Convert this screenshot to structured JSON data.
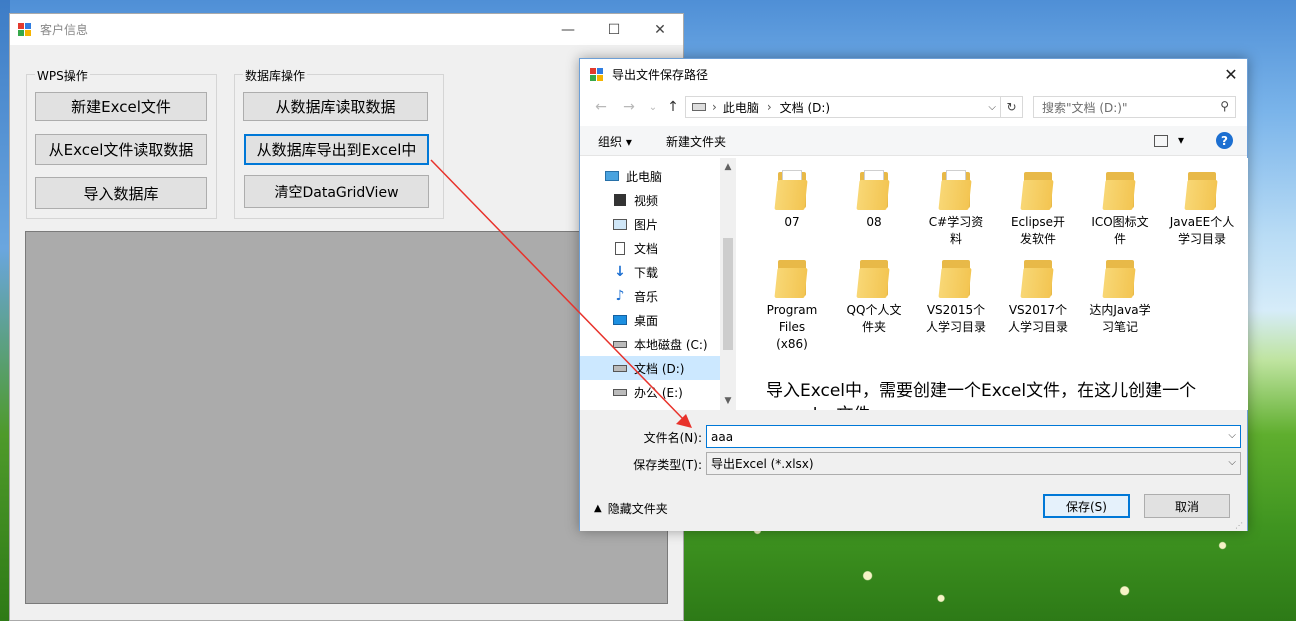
{
  "main_window": {
    "title": "客户信息",
    "controls": {
      "minimize": "—",
      "maximize": "☐",
      "close": "✕"
    },
    "wps_group": {
      "legend": "WPS操作",
      "buttons": [
        "新建Excel文件",
        "从Excel文件读取数据",
        "导入数据库"
      ]
    },
    "db_group": {
      "legend": "数据库操作",
      "buttons": [
        "从数据库读取数据",
        "从数据库导出到Excel中",
        "清空DataGridView"
      ]
    }
  },
  "dialog": {
    "title": "导出文件保存路径",
    "close": "✕",
    "nav": {
      "back": "←",
      "forward": "→",
      "recent": "⌄",
      "up": "↑",
      "refresh": "↻"
    },
    "address": {
      "segments": [
        "此电脑",
        "文档 (D:)"
      ],
      "sep": "›"
    },
    "search": {
      "placeholder": "搜索\"文档 (D:)\""
    },
    "toolbar": {
      "organize": "组织 ▾",
      "new_folder": "新建文件夹",
      "view": "▾",
      "help": "?"
    },
    "tree": [
      {
        "label": "此电脑",
        "icon": "computer-icon"
      },
      {
        "label": "视频",
        "icon": "video-icon"
      },
      {
        "label": "图片",
        "icon": "picture-icon"
      },
      {
        "label": "文档",
        "icon": "document-icon"
      },
      {
        "label": "下载",
        "icon": "download-icon"
      },
      {
        "label": "音乐",
        "icon": "music-icon"
      },
      {
        "label": "桌面",
        "icon": "desktop-icon"
      },
      {
        "label": "本地磁盘 (C:)",
        "icon": "drive-icon"
      },
      {
        "label": "文档 (D:)",
        "icon": "drive-icon",
        "selected": true
      },
      {
        "label": "办公 (E:)",
        "icon": "drive-icon"
      }
    ],
    "files": [
      {
        "name": "07"
      },
      {
        "name": "08"
      },
      {
        "name": "C#学习资料"
      },
      {
        "name": "Eclipse开发软件"
      },
      {
        "name": "ICO图标文件"
      },
      {
        "name": "JavaEE个人学习目录"
      },
      {
        "name": "Program Files (x86)"
      },
      {
        "name": "QQ个人文件夹"
      },
      {
        "name": "VS2015个人学习目录"
      },
      {
        "name": "VS2017个人学习目录"
      },
      {
        "name": "达内Java学习笔记"
      }
    ],
    "annotation": "导入Excel中，需要创建一个Excel文件，在这儿创建一个aaa.xlsx文件。",
    "filename_label": "文件名(N):",
    "filename_value": "aaa",
    "filetype_label": "保存类型(T):",
    "filetype_value": "导出Excel (*.xlsx)",
    "hide_folders": "隐藏文件夹",
    "save_button": "保存(S)",
    "cancel_button": "取消"
  },
  "colors": {
    "accent": "#0078d7",
    "annotation_arrow": "#e8322b",
    "folder": "#f3c552"
  }
}
